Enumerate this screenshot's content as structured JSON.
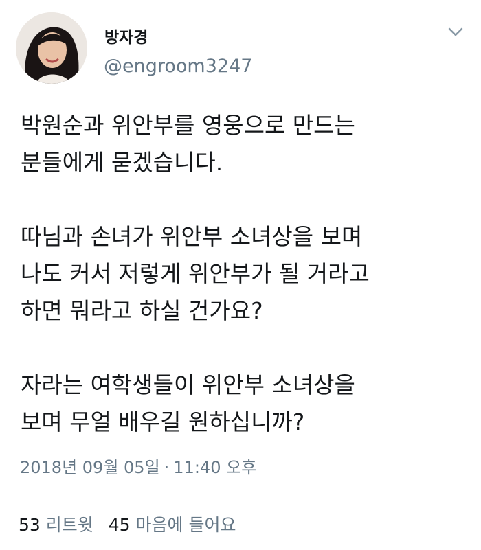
{
  "user": {
    "display_name": "방자경",
    "handle": "@engroom3247",
    "avatar": "profile-photo"
  },
  "tweet": {
    "paragraphs": [
      {
        "lines": [
          "박원순과 위안부를 영웅으로 만드는",
          "분들에게 묻겠습니다."
        ]
      },
      {
        "lines": [
          "따님과 손녀가 위안부 소녀상을 보며",
          "나도 커서 저렇게 위안부가 될 거라고",
          "하면 뭐라고 하실 건가요?"
        ]
      },
      {
        "lines": [
          "자라는 여학생들이 위안부 소녀상을",
          "보며 무얼 배우길 원하십니까?"
        ]
      }
    ],
    "date": "2018년 09월 05일",
    "separator": "·",
    "time": "11:40 오후"
  },
  "stats": {
    "retweet_count": "53",
    "retweet_label": "리트윗",
    "like_count": "45",
    "like_label": "마음에 들어요"
  },
  "icons": {
    "menu": "chevron-down-icon"
  },
  "colors": {
    "text": "#14171a",
    "secondary": "#657786",
    "divider": "#e6ecf0"
  }
}
